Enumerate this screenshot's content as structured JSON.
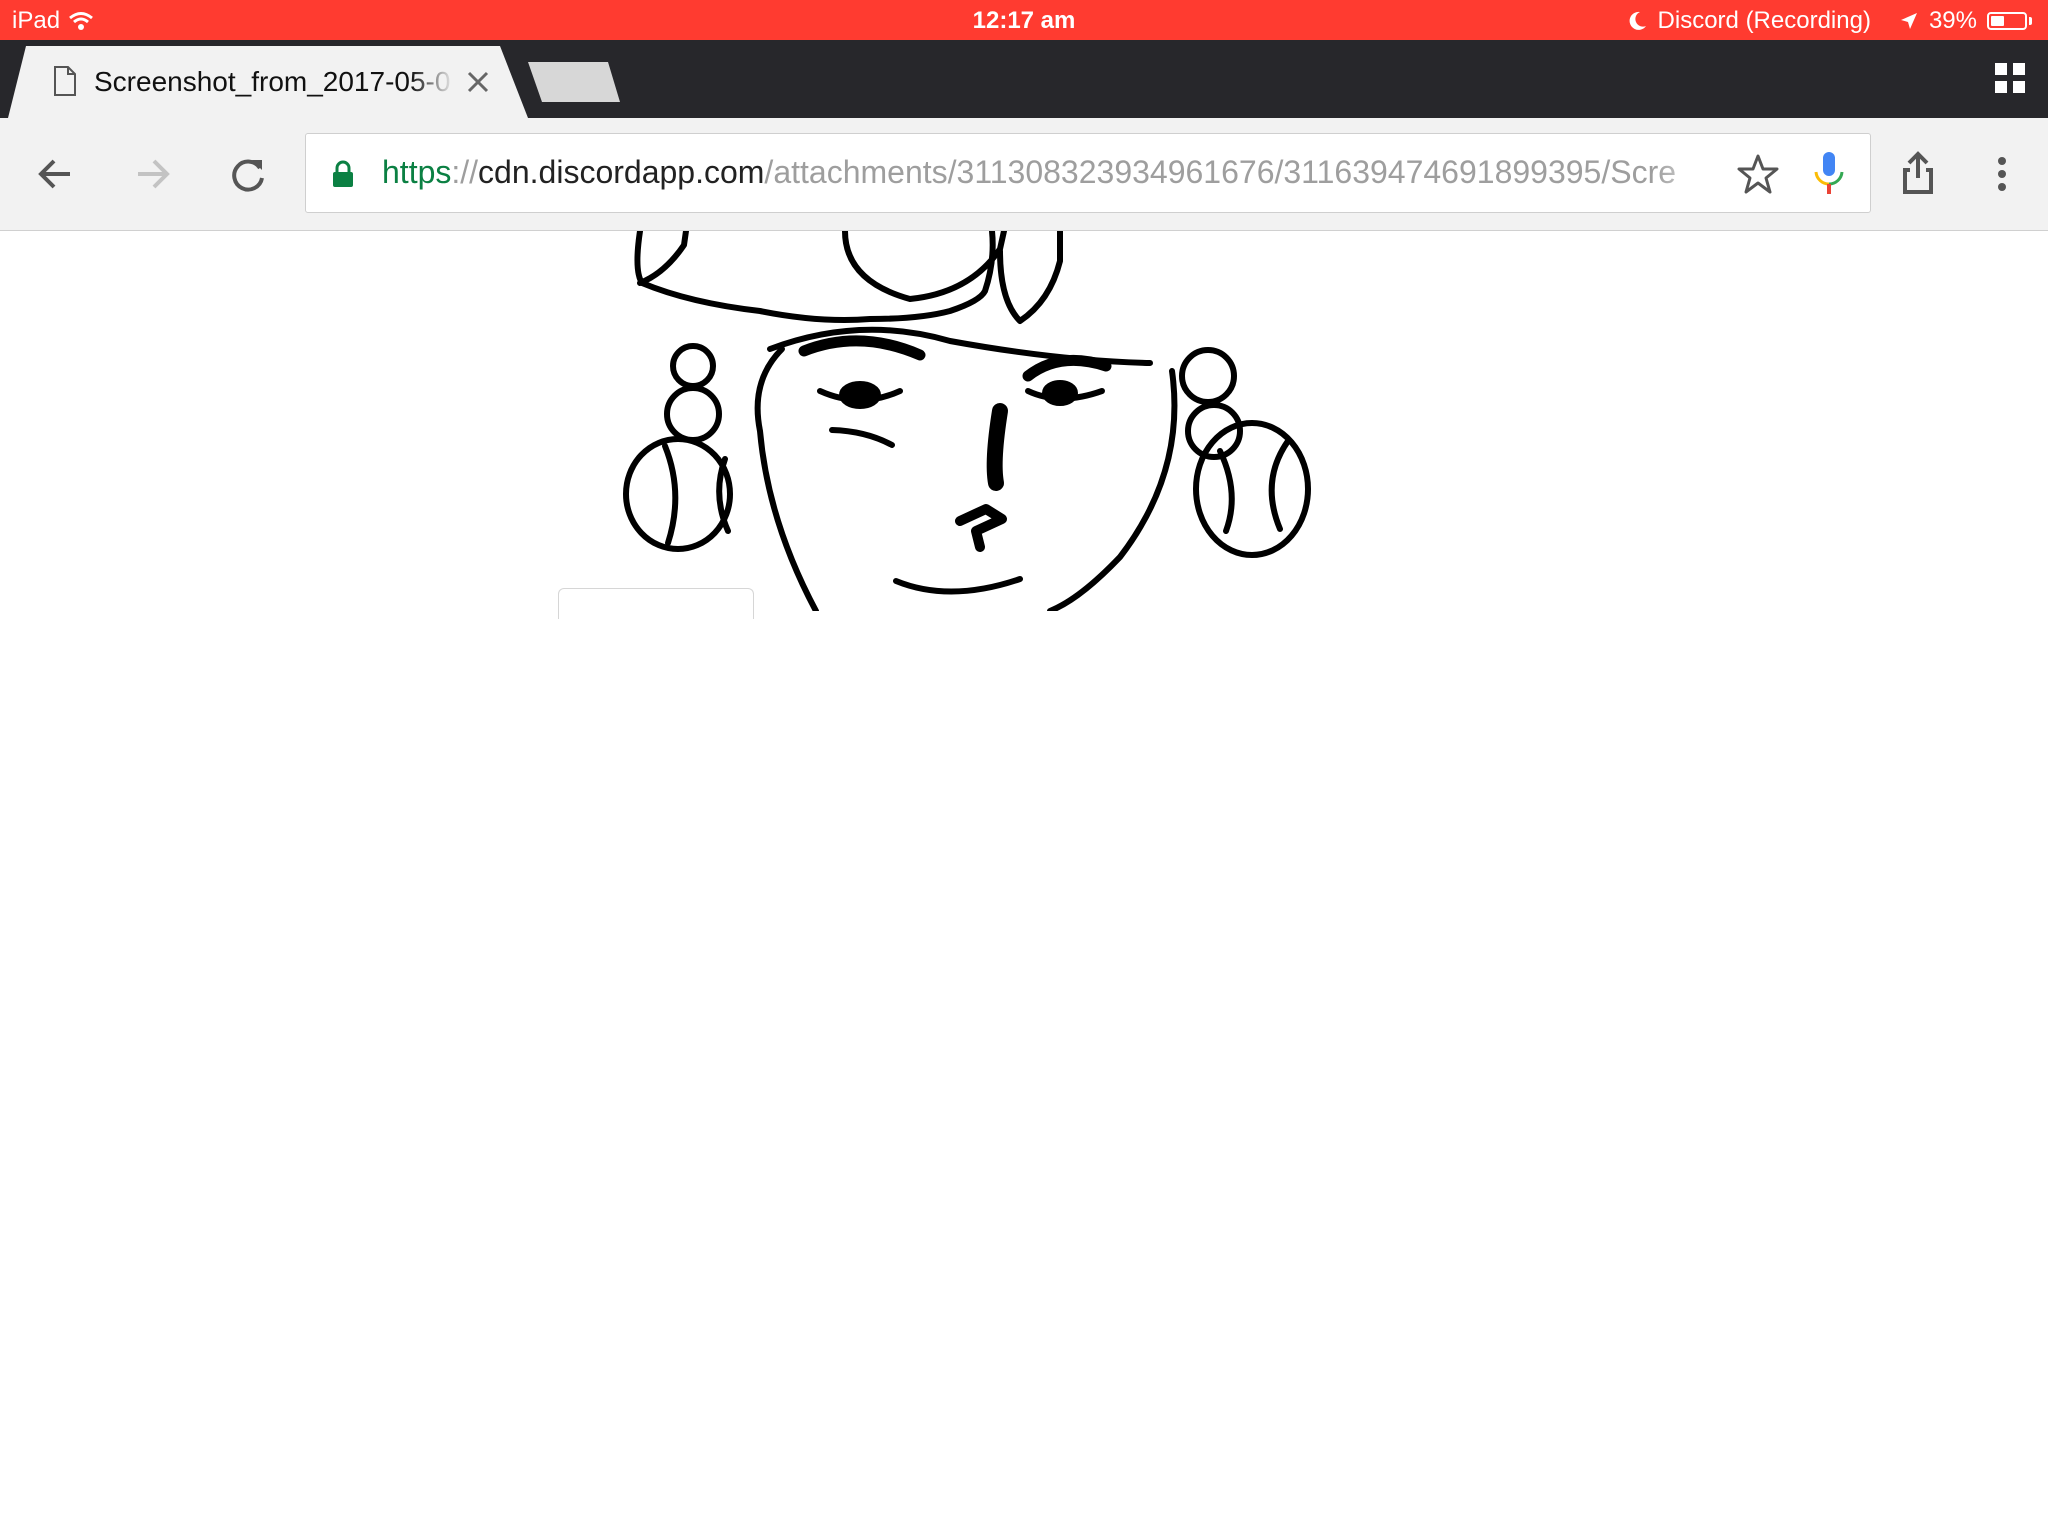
{
  "status_bar": {
    "device": "iPad",
    "time": "12:17 am",
    "app_status": "Discord (Recording)",
    "battery": "39%",
    "battery_level": 0.39,
    "bar_color": "#ff3b30"
  },
  "tab": {
    "title": "Screenshot_from_2017-05-0",
    "icons": [
      "file-icon",
      "close-icon",
      "new-tab-icon",
      "tab-switcher-icon"
    ]
  },
  "toolbar": {
    "url_scheme": "https",
    "url_separator": "://",
    "url_host": "cdn.discordapp.com",
    "url_path": "/attachments/311308323934961676/311639474691899395/Scre",
    "icons": [
      "back-icon",
      "forward-icon",
      "reload-icon",
      "lock-icon",
      "bookmark-star-icon",
      "mic-icon",
      "share-icon",
      "menu-icon"
    ],
    "secure_color": "#0b8043"
  }
}
